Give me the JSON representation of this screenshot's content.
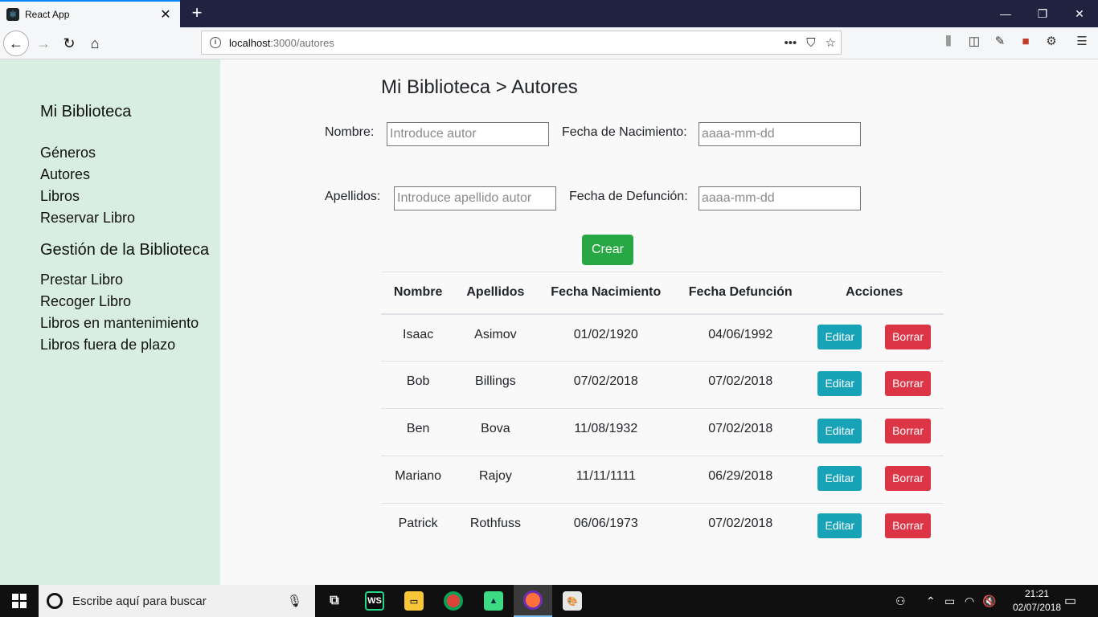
{
  "browser": {
    "tab_title": "React App",
    "tab_close": "✕",
    "new_tab": "+",
    "url_host": "localhost",
    "url_path": ":3000/autores",
    "url_more": "•••",
    "window_controls": {
      "minimize": "—",
      "restore": "❐",
      "close": "✕"
    }
  },
  "sidebar": {
    "brand": "Mi Biblioteca",
    "links": [
      "Géneros",
      "Autores",
      "Libros",
      "Reservar Libro"
    ],
    "section_title": "Gestión de la Biblioteca",
    "management_links": [
      "Prestar Libro",
      "Recoger Libro",
      "Libros en mantenimiento",
      "Libros fuera de plazo"
    ]
  },
  "main": {
    "title": "Mi Biblioteca > Autores",
    "form": {
      "nombre_label": "Nombre:",
      "nombre_placeholder": "Introduce autor",
      "apellidos_label": "Apellidos:",
      "apellidos_placeholder": "Introduce apellido autor",
      "nacimiento_label": "Fecha de Nacimiento:",
      "nacimiento_placeholder": "aaaa-mm-dd",
      "defuncion_label": "Fecha de Defunción:",
      "defuncion_placeholder": "aaaa-mm-dd",
      "create_label": "Crear"
    },
    "table": {
      "headers": [
        "Nombre",
        "Apellidos",
        "Fecha Nacimiento",
        "Fecha Defunción",
        "Acciones"
      ],
      "edit_label": "Editar",
      "delete_label": "Borrar",
      "rows": [
        [
          "Isaac",
          "Asimov",
          "01/02/1920",
          "04/06/1992"
        ],
        [
          "Bob",
          "Billings",
          "07/02/2018",
          "07/02/2018"
        ],
        [
          "Ben",
          "Bova",
          "11/08/1932",
          "07/02/2018"
        ],
        [
          "Mariano",
          "Rajoy",
          "11/11/1111",
          "06/29/2018"
        ],
        [
          "Patrick",
          "Rothfuss",
          "06/06/1973",
          "07/02/2018"
        ]
      ]
    }
  },
  "taskbar": {
    "search_placeholder": "Escribe aquí para buscar",
    "time": "21:21",
    "date": "02/07/2018",
    "apps": [
      "task-view",
      "webstorm",
      "file-explorer",
      "chrome",
      "android-studio",
      "firefox",
      "paint"
    ]
  },
  "colors": {
    "sidebar_bg": "#d9eee3",
    "create_button": "#28a745",
    "edit_button": "#17a2b8",
    "delete_button": "#dc3545"
  }
}
